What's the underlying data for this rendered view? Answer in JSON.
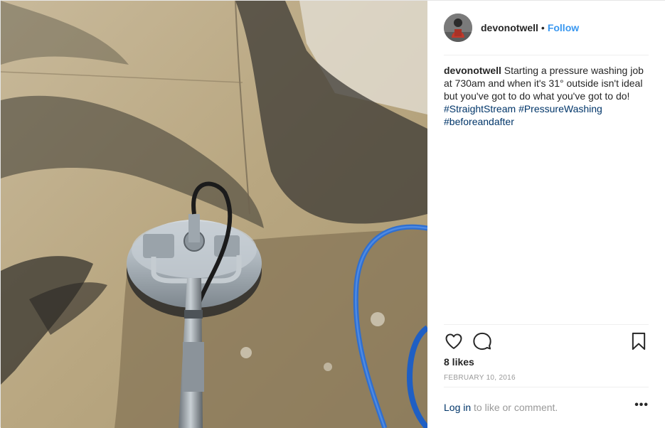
{
  "post": {
    "username": "devonotwell",
    "separator": "•",
    "follow_label": "Follow",
    "caption": {
      "username": "devonotwell",
      "text": "Starting a pressure washing job at 730am and when it's 31° outside isn't ideal but you've got to do what you've got to do!",
      "hashtags": [
        "#StraightStream",
        "#PressureWashing",
        "#beforeandafter"
      ]
    },
    "actions": {
      "like_icon": "heart-icon",
      "comment_icon": "comment-icon",
      "save_icon": "bookmark-icon"
    },
    "likes": "8 likes",
    "date": "FEBRUARY 10, 2016",
    "login": {
      "link_label": "Log in",
      "rest": " to like or comment.",
      "more_label": "•••"
    }
  },
  "colors": {
    "link_blue": "#3897f0",
    "hashtag": "#003569",
    "muted": "#999999",
    "text": "#262626"
  }
}
